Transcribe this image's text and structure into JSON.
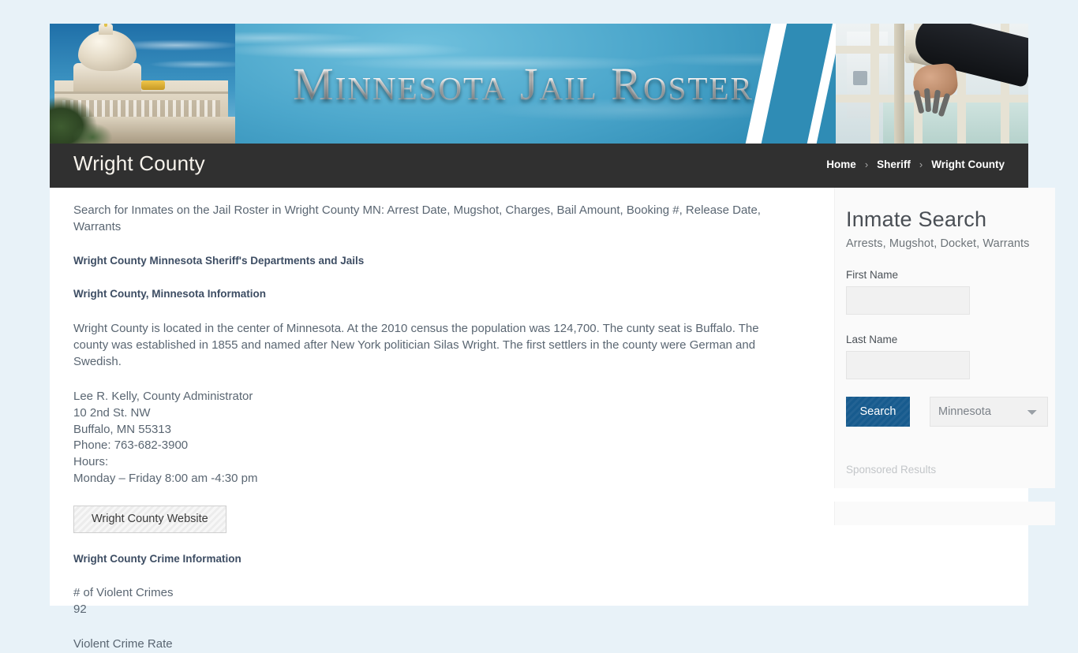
{
  "banner": {
    "title": "Minnesota Jail Roster",
    "left_image": "minnesota-state-capitol-photo",
    "right_image": "jail-cell-door-with-hand-and-keys-photo"
  },
  "titlebar": {
    "page_title": "Wright County",
    "breadcrumb": [
      {
        "label": "Home",
        "current": false
      },
      {
        "label": "Sheriff",
        "current": false
      },
      {
        "label": "Wright County",
        "current": true
      }
    ],
    "separator": "›"
  },
  "main": {
    "intro": "Search for Inmates on the Jail Roster in Wright County MN: Arrest Date, Mugshot, Charges, Bail Amount, Booking #, Release Date, Warrants",
    "heading_departments": "Wright County Minnesota Sheriff's Departments and Jails",
    "heading_information": "Wright County, Minnesota Information",
    "description": "Wright County is located in the center of Minnesota. At the 2010 census the population was 124,700. The cunty seat is Buffalo. The county was established in 1855 and named after New York politician Silas Wright. The first settlers in the county were German and Swedish.",
    "contact": {
      "line1": "Lee R. Kelly, County Administrator",
      "line2": "10 2nd St. NW",
      "line3": "Buffalo, MN 55313",
      "line4": "Phone: 763-682-3900",
      "line5": "Hours:",
      "line6": "Monday – Friday 8:00 am -4:30 pm"
    },
    "website_button": "Wright County Website",
    "heading_crime": "Wright County Crime Information",
    "crime": {
      "violent_label": "# of Violent Crimes",
      "violent_value": "92",
      "rate_label": "Violent Crime Rate"
    }
  },
  "sidebar": {
    "search_widget": {
      "title": "Inmate Search",
      "subtitle": "Arrests, Mugshot, Docket, Warrants",
      "first_name_label": "First Name",
      "first_name_value": "",
      "first_name_placeholder": "",
      "last_name_label": "Last Name",
      "last_name_value": "",
      "last_name_placeholder": "",
      "search_button": "Search",
      "state_selected": "Minnesota",
      "state_options": [
        "Minnesota"
      ],
      "sponsored_label": "Sponsored Results"
    }
  },
  "colors": {
    "page_background": "#e8f2f8",
    "banner_blue": "#2f8cb5",
    "titlebar_dark": "#303030",
    "accent_blue": "#175b8e",
    "body_text": "#5a6672",
    "heading_text": "#3d4d63"
  }
}
